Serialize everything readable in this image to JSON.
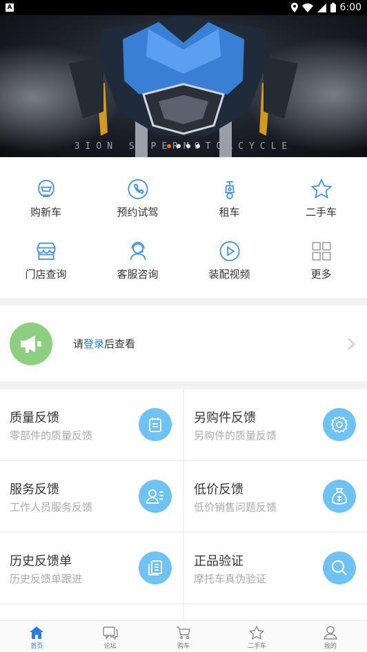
{
  "status_bar": {
    "time": "6:00",
    "app_badge": "A"
  },
  "banner": {
    "caption": "3ION SUPERMOTORCYCLE"
  },
  "quick_menu": [
    {
      "label": "购新车",
      "icon": "helmet-icon"
    },
    {
      "label": "预约试驾",
      "icon": "phone-icon"
    },
    {
      "label": "租车",
      "icon": "scooter-icon"
    },
    {
      "label": "二手车",
      "icon": "star-icon"
    },
    {
      "label": "门店查询",
      "icon": "store-icon"
    },
    {
      "label": "客服咨询",
      "icon": "customer-service-icon"
    },
    {
      "label": "装配视频",
      "icon": "play-icon"
    },
    {
      "label": "更多",
      "icon": "grid-icon"
    }
  ],
  "notice": {
    "prefix": "请",
    "link": "登录",
    "suffix": "后查看"
  },
  "cards": [
    {
      "title": "质量反馈",
      "subtitle": "零部件的质量反馈",
      "icon": "clipboard-icon"
    },
    {
      "title": "另购件反馈",
      "subtitle": "另购件的质量反馈",
      "icon": "gear-icon"
    },
    {
      "title": "服务反馈",
      "subtitle": "工作人员服务反馈",
      "icon": "user-list-icon"
    },
    {
      "title": "低价反馈",
      "subtitle": "低价销售问题反馈",
      "icon": "money-bag-icon"
    },
    {
      "title": "历史反馈单",
      "subtitle": "历史反馈单跟进",
      "icon": "documents-icon"
    },
    {
      "title": "正品验证",
      "subtitle": "摩托车真伪验证",
      "icon": "search-icon"
    }
  ],
  "tabs": [
    {
      "label": "首页",
      "icon": "home-icon",
      "active": true
    },
    {
      "label": "论坛",
      "icon": "chat-icon",
      "active": false
    },
    {
      "label": "购车",
      "icon": "cart-icon",
      "active": false
    },
    {
      "label": "二手车",
      "icon": "star-icon",
      "active": false
    },
    {
      "label": "我的",
      "icon": "person-icon",
      "active": false
    }
  ],
  "colors": {
    "accent": "#2a7fe0",
    "icon_blue": "#3f8ee6",
    "card_circle": "#6ec3f4",
    "notice_green": "#8ccf7e"
  }
}
